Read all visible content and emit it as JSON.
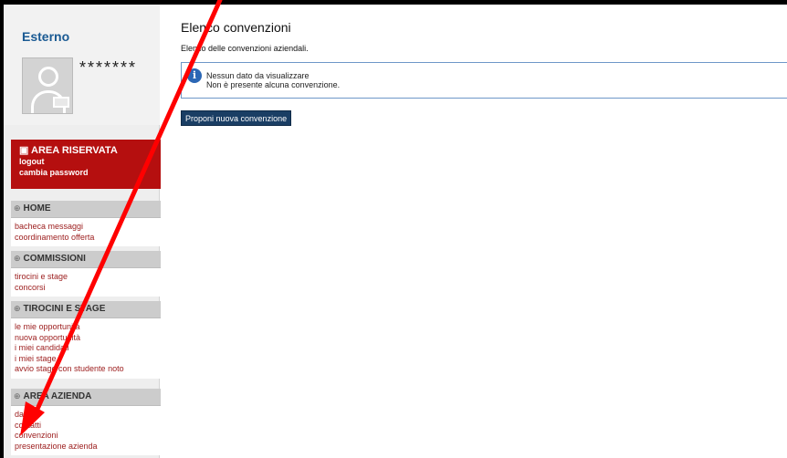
{
  "user": {
    "title": "Esterno",
    "masked_name": "*******"
  },
  "reserved_area": {
    "title": "AREA RISERVATA",
    "links": [
      "logout",
      "cambia password"
    ]
  },
  "menu": {
    "sections": [
      {
        "title": "HOME",
        "items": [
          "bacheca messaggi",
          "coordinamento offerta"
        ]
      },
      {
        "title": "COMMISSIONI",
        "items": [
          "tirocini e stage",
          "concorsi"
        ]
      },
      {
        "title": "TIROCINI E STAGE",
        "items": [
          "le mie opportunità",
          "nuova opportunità",
          "i miei candidati",
          "i miei stage",
          "avvio stage con studente noto"
        ]
      },
      {
        "title": "AREA AZIENDA",
        "items": [
          "dati",
          "contatti",
          "convenzioni",
          "presentazione azienda"
        ]
      }
    ]
  },
  "main": {
    "title": "Elenco convenzioni",
    "description": "Elenco delle convenzioni aziendali.",
    "notice": {
      "line1": "Nessun dato da visualizzare",
      "line2": "Non è presente alcuna convenzione."
    },
    "propose_button": "Proponi nuova convenzione"
  },
  "colors": {
    "reserved_bg": "#b50f0f",
    "link": "#9b1b1b",
    "button_bg": "#1a3e64",
    "annotation_arrow": "#ff0000"
  }
}
